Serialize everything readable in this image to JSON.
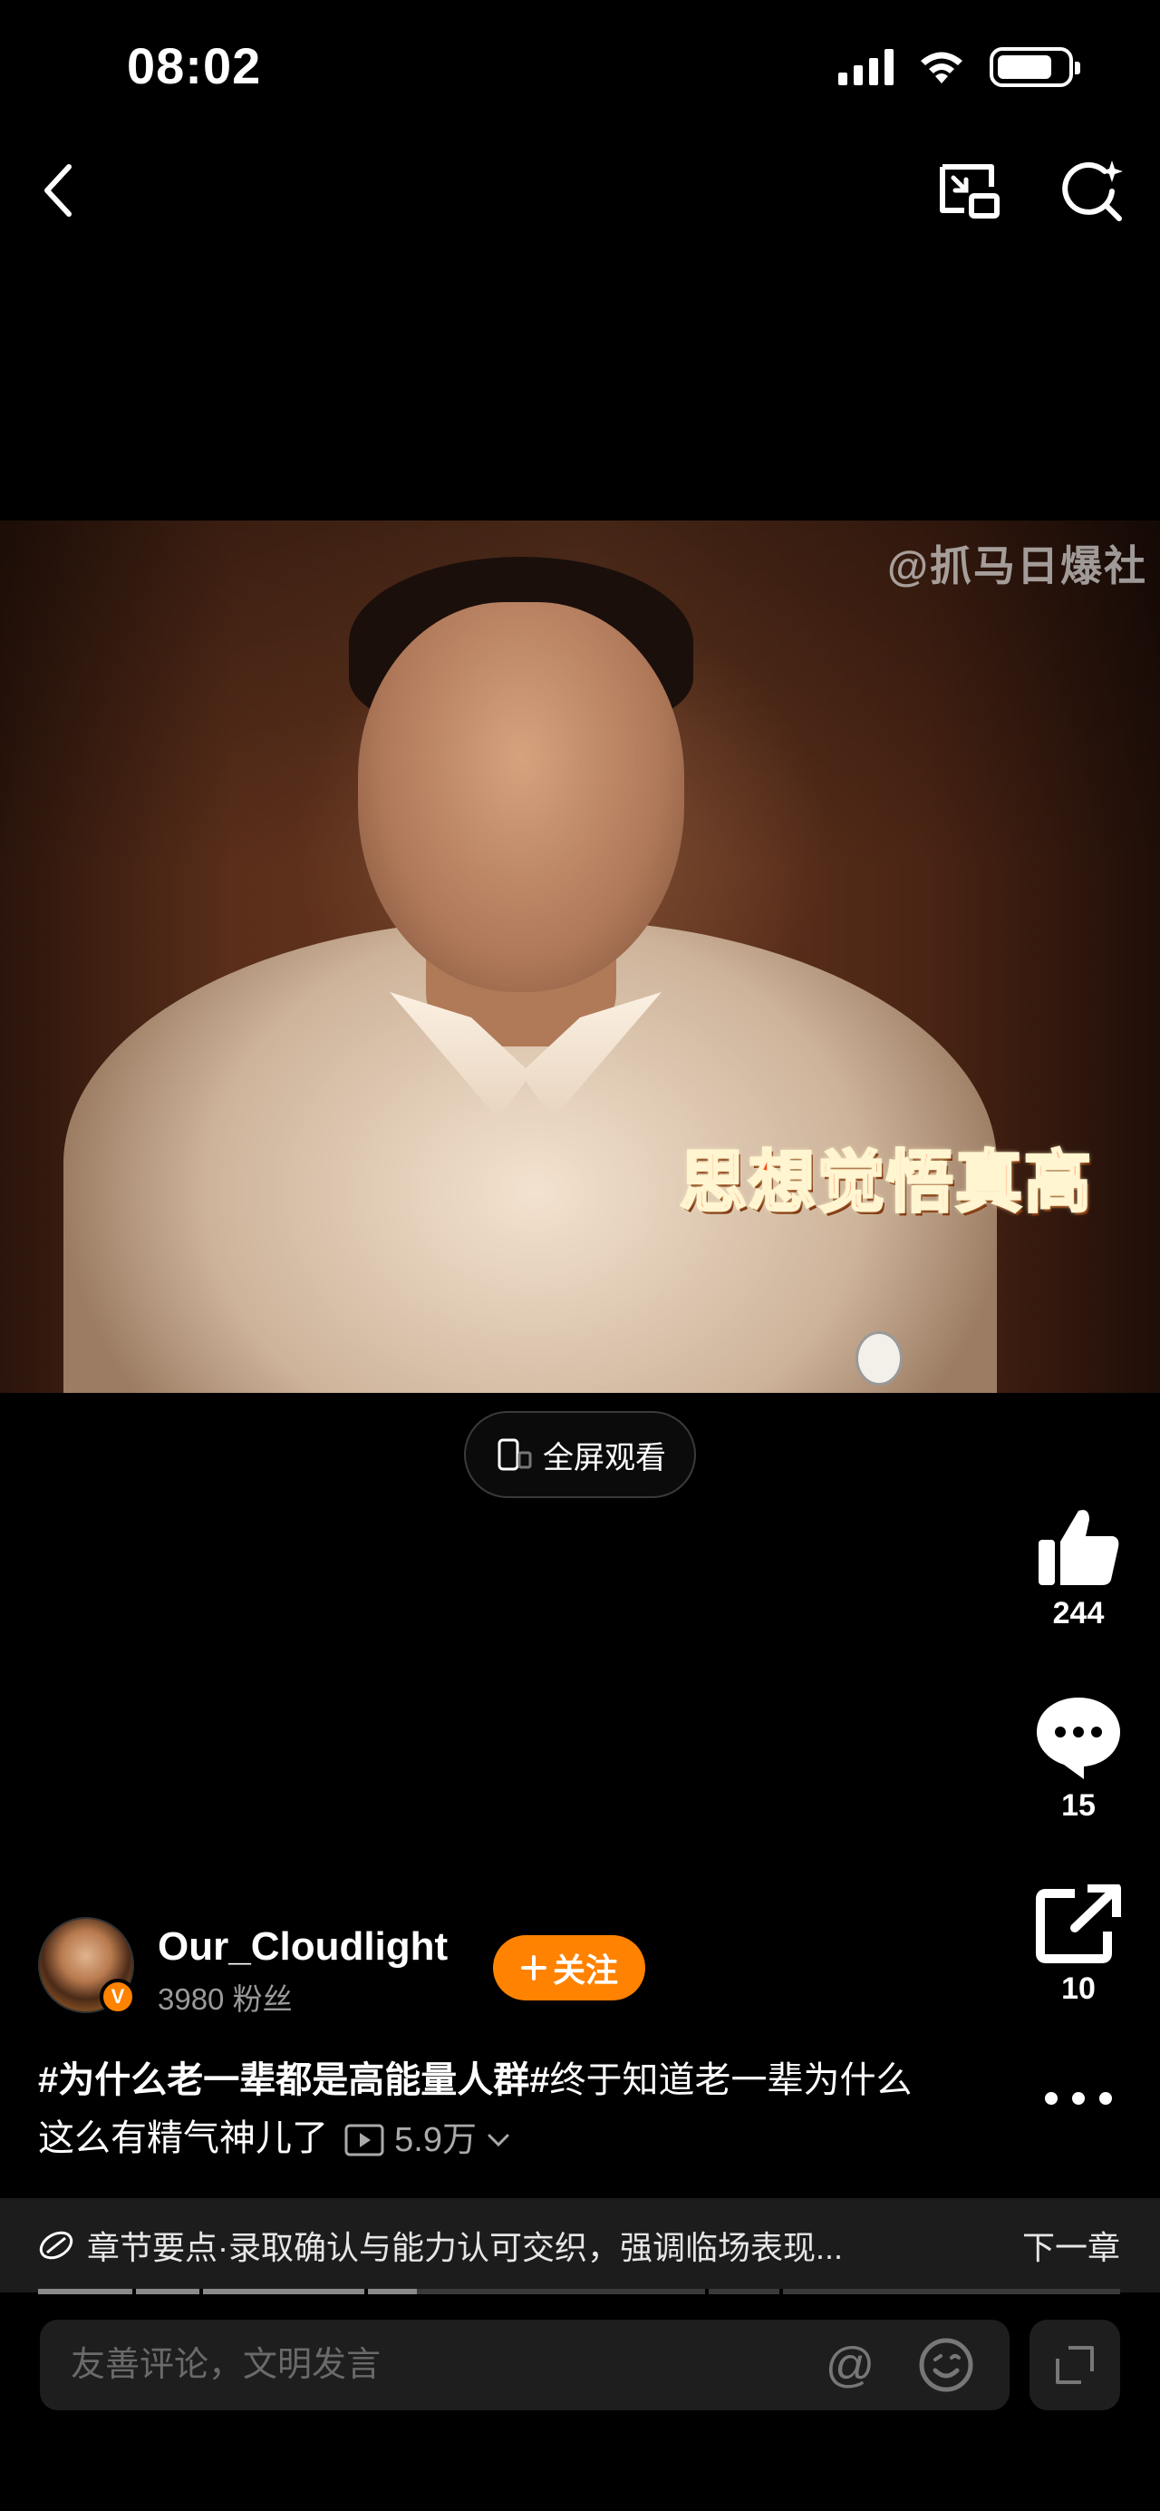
{
  "status_bar": {
    "time": "08:02",
    "icons": [
      "cellular-signal-icon",
      "wifi-icon",
      "battery-icon"
    ],
    "battery_level": 0.8
  },
  "top_nav": {
    "icons": [
      "back-chevron-icon",
      "picture-in-picture-icon",
      "ai-search-icon"
    ]
  },
  "video": {
    "watermark": "@抓马日爆社",
    "caption": "思想觉悟真高"
  },
  "fullscreen": {
    "label": "全屏观看"
  },
  "actions": {
    "like_count": "244",
    "comment_count": "15",
    "share_count": "10"
  },
  "author": {
    "name": "Our_Cloudlight",
    "verified_mark": "V",
    "fans": "3980 粉丝",
    "follow_label": "关注"
  },
  "description": {
    "hashtag": "#为什么老一辈都是高能量人群#",
    "text": "终于知道老一辈为什么这么有精气神儿了",
    "views": "5.9万"
  },
  "chapter": {
    "text": "章节要点·录取确认与能力认可交织，强调临场表现...",
    "next_label": "下一章",
    "progress": 0.35
  },
  "comment": {
    "placeholder": "友善评论，文明发言"
  },
  "colors": {
    "accent": "#ff8200",
    "background": "#000000",
    "chapter_bar": "#1c1c1c",
    "input_bg": "#1e1e1e",
    "caption_red": "#ff4d1a"
  }
}
